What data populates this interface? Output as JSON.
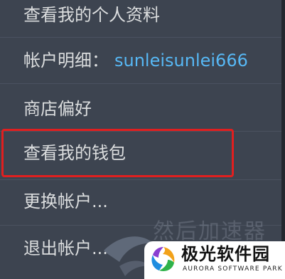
{
  "menu": {
    "view_profile": "查看我的个人资料",
    "account_details_label": "帐户明细：",
    "account_name": "sunleisunlei666",
    "store_preferences": "商店偏好",
    "view_wallet": "查看我的钱包",
    "change_account": "更换帐户...",
    "logout": "退出帐户..."
  },
  "watermark": {
    "background_text": "然后加速器",
    "logo_title": "极光软件园",
    "logo_subtitle": "AURORA SOFTWARE PARK"
  },
  "colors": {
    "background": "#3d4450",
    "text": "#dcdedf",
    "link": "#57b8f5",
    "highlight_border": "#e11f1f"
  }
}
